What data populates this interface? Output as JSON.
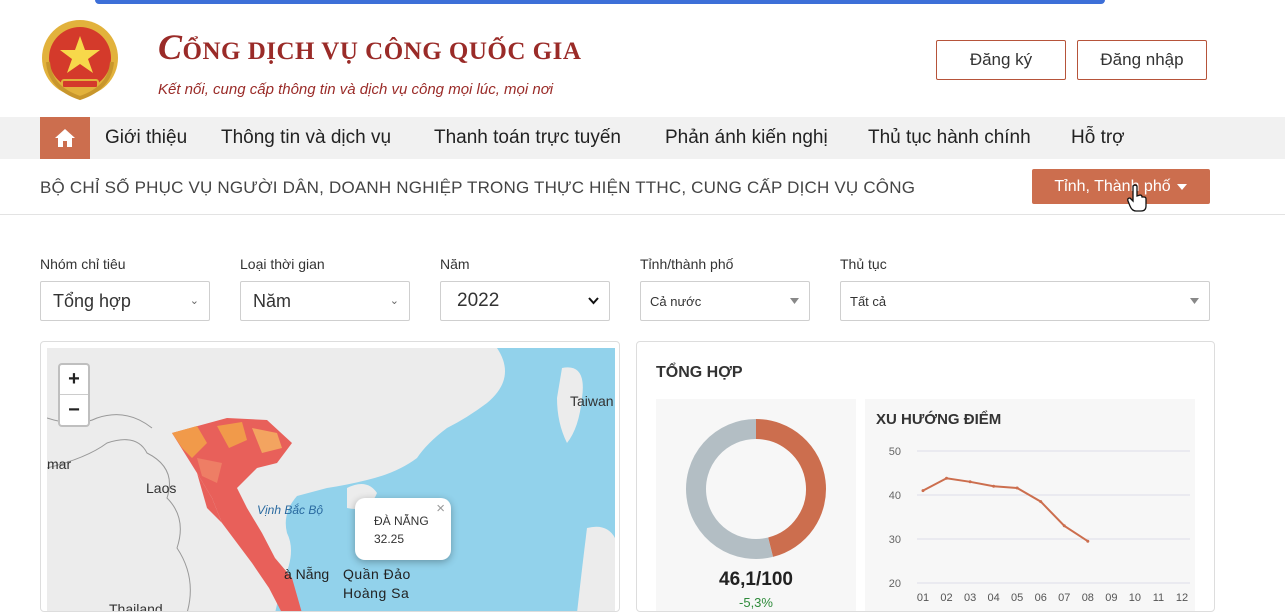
{
  "header": {
    "title": "CỔNG DỊCH VỤ CÔNG QUỐC GIA",
    "title_first": "C",
    "title_rest": "ỔNG DỊCH VỤ CÔNG QUỐC GIA",
    "subtitle": "Kết nối, cung cấp thông tin và dịch vụ công mọi lúc, mọi nơi",
    "register_label": "Đăng ký",
    "login_label": "Đăng nhập",
    "emblem_icon": "national-emblem-icon"
  },
  "nav": {
    "home_icon": "home-icon",
    "items": [
      "Giới thiệu",
      "Thông tin và dịch vụ",
      "Thanh toán trực tuyến",
      "Phản ánh kiến nghị",
      "Thủ tục hành chính",
      "Hỗ trợ"
    ]
  },
  "subbar": {
    "text": "BỘ CHỈ SỐ PHỤC VỤ NGƯỜI DÂN, DOANH NGHIỆP TRONG THỰC HIỆN TTHC, CUNG CẤP DỊCH VỤ CÔNG",
    "province_button": "Tỉnh, Thành phố"
  },
  "filters": {
    "group": {
      "label": "Nhóm chỉ tiêu",
      "value": "Tổng hợp"
    },
    "time_type": {
      "label": "Loại thời gian",
      "value": "Năm"
    },
    "year": {
      "label": "Năm",
      "value": "2022"
    },
    "province": {
      "label": "Tỉnh/thành phố",
      "value": "Cả nước"
    },
    "procedure": {
      "label": "Thủ tục",
      "value": "Tất cả"
    }
  },
  "map": {
    "zoom_in": "+",
    "zoom_out": "−",
    "labels": {
      "myanmar": "mar",
      "laos": "Laos",
      "gulf": "Vịnh Bắc Bộ",
      "taiwan": "Taiwan",
      "danang": "à Nẵng",
      "paracel1": "Quần Đảo",
      "paracel2": "Hoàng Sa",
      "thailand": "Thailand"
    },
    "popup": {
      "name": "ĐÀ NẴNG",
      "value": "32.25",
      "close": "×"
    }
  },
  "summary": {
    "title": "TỔNG HỢP",
    "score": "46,1/100",
    "change": "-5,3%",
    "trend_title": "XU HƯỚNG ĐIỂM"
  },
  "colors": {
    "accent": "#cc6e4e",
    "brand": "#9a2b28",
    "donut_rest": "#b3bec4",
    "sea": "#92d2eb"
  },
  "chart_data": [
    {
      "type": "pie",
      "title": "",
      "labels": [
        "score",
        "remaining"
      ],
      "values": [
        46.1,
        53.9
      ]
    },
    {
      "type": "line",
      "title": "XU HƯỚNG ĐIỂM",
      "categories": [
        "01",
        "02",
        "03",
        "04",
        "05",
        "06",
        "07",
        "08",
        "09",
        "10",
        "11",
        "12"
      ],
      "series": [
        {
          "values": [
            41,
            43.8,
            43,
            42,
            41.6,
            38.5,
            33,
            29.5,
            null,
            null,
            null,
            null
          ]
        }
      ],
      "ylim": [
        20,
        50
      ],
      "yticks": [
        20,
        30,
        40,
        50
      ],
      "grid": true
    }
  ]
}
